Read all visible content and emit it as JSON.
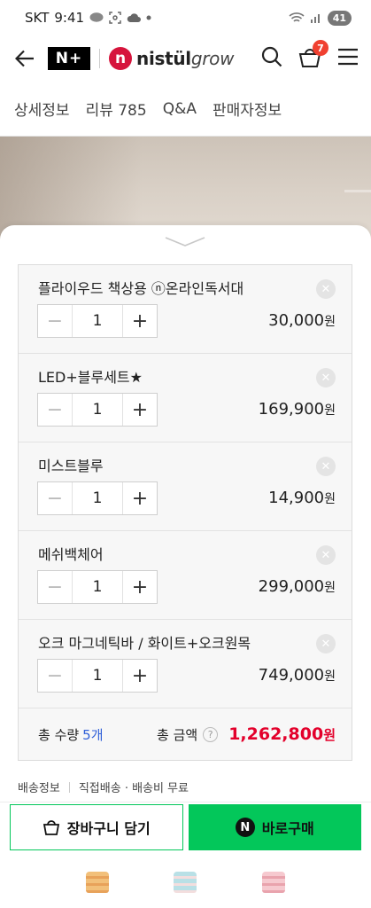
{
  "status_bar": {
    "carrier": "SKT",
    "time": "9:41",
    "battery": "41"
  },
  "header": {
    "nplus_logo": "N+",
    "brand_name_bold": "nistül",
    "brand_name_light": "grow",
    "cart_count": "7"
  },
  "tabs": [
    {
      "label": "상세정보"
    },
    {
      "label": "리뷰 785"
    },
    {
      "label": "Q&A"
    },
    {
      "label": "판매자정보"
    }
  ],
  "options": [
    {
      "name": "플라이우드 책상용 ⓝ온라인독서대",
      "qty": "1",
      "price": "30,000",
      "unit": "원"
    },
    {
      "name": "LED+블루세트★",
      "qty": "1",
      "price": "169,900",
      "unit": "원"
    },
    {
      "name": "미스트블루",
      "qty": "1",
      "price": "14,900",
      "unit": "원"
    },
    {
      "name": "메쉬백체어",
      "qty": "1",
      "price": "299,000",
      "unit": "원"
    },
    {
      "name": "오크 마그네틱바 / 화이트+오크원목",
      "qty": "1",
      "price": "749,000",
      "unit": "원"
    }
  ],
  "summary": {
    "qty_label": "총 수량",
    "qty_value": "5개",
    "amount_label": "총 금액",
    "help": "?",
    "amount_value": "1,262,800",
    "amount_unit": "원"
  },
  "delivery": {
    "label": "배송정보",
    "value": "직접배송 · 배송비 무료"
  },
  "actions": {
    "cart_label": "장바구니 담기",
    "buy_label": "바로구매",
    "npay_mark": "N"
  },
  "colors": {
    "accent_green": "#03c75a",
    "price_red": "#e3002b",
    "qty_blue": "#2f5fd8",
    "brand_red": "#d6143c"
  }
}
